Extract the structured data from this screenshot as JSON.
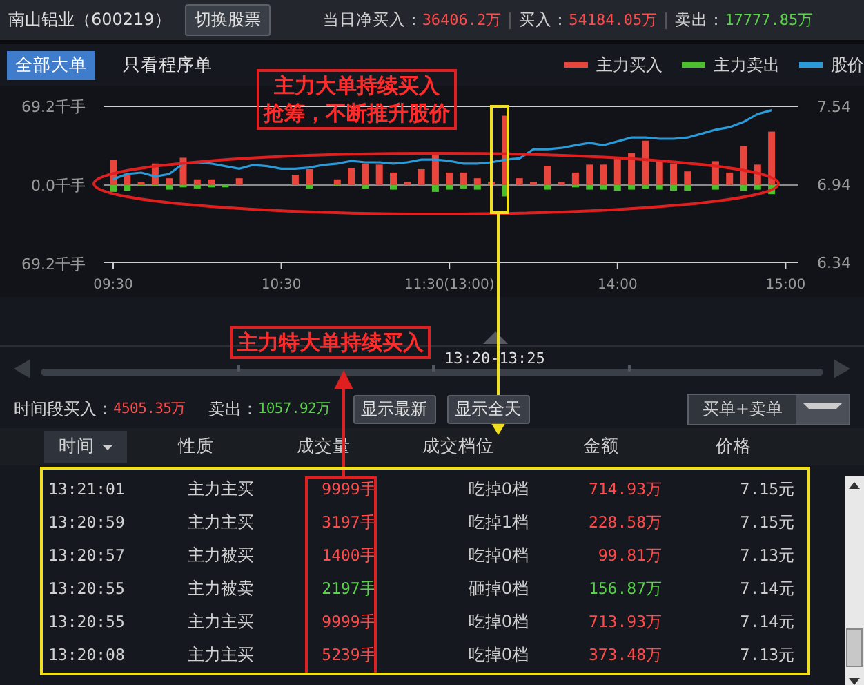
{
  "header": {
    "stock": "南山铝业（600219）",
    "switch_button": "切换股票",
    "stats": [
      {
        "label": "当日净买入：",
        "value": "36406.2万",
        "kind": "buy"
      },
      {
        "label": "买入：",
        "value": "54184.05万",
        "kind": "buy"
      },
      {
        "label": "卖出：",
        "value": "17777.85万",
        "kind": "sell"
      }
    ]
  },
  "tabs": [
    {
      "label": "全部大单",
      "selected": true
    },
    {
      "label": "只看程序单",
      "selected": false
    }
  ],
  "chart": {
    "volume": {
      "chart_data": {
        "type": "bar",
        "stacked": true,
        "categories": [
          "09:30",
          null,
          null,
          null,
          null,
          null,
          null,
          null,
          null,
          null,
          null,
          null,
          "10:30",
          null,
          null,
          null,
          null,
          null,
          null,
          null,
          null,
          null,
          null,
          null,
          "11:30(13:00)",
          null,
          null,
          null,
          null,
          null,
          null,
          null,
          null,
          null,
          null,
          null,
          "14:00",
          null,
          null,
          null,
          null,
          null,
          null,
          null,
          null,
          null,
          null,
          null,
          "15:00"
        ],
        "ylim": [
          -69.2,
          69.2
        ],
        "yticks": [
          {
            "value": 69.2,
            "label": "69.2千手"
          },
          {
            "value": 0,
            "label": "0.0千手"
          },
          {
            "value": -69.2,
            "label": "69.2千手"
          }
        ],
        "series": [
          {
            "name": "主力买入",
            "type": "bar",
            "color": "#e8453c",
            "values": [
              22,
              10,
              3,
              19,
              6,
              24,
              5,
              5,
              0,
              6,
              0,
              0,
              0,
              9,
              14,
              0,
              5,
              15,
              19,
              18,
              11,
              3,
              14,
              28,
              11,
              11,
              6,
              3,
              61,
              6,
              3,
              17,
              3,
              11,
              18,
              18,
              23,
              28,
              39,
              21,
              19,
              12,
              0,
              21,
              11,
              34,
              18,
              47,
              null
            ]
          },
          {
            "name": "主力卖出",
            "type": "bar",
            "color": "#4cc02c",
            "values": [
              -6,
              -5,
              -1,
              -1,
              -4,
              -2,
              -3,
              -2,
              -2,
              0,
              0,
              0,
              0,
              0,
              -3,
              0,
              -1,
              0,
              -3,
              0,
              -4,
              0,
              0,
              -6,
              -4,
              -3,
              -4,
              0,
              -10,
              0,
              0,
              -4,
              0,
              -2,
              -4,
              -4,
              -5,
              -4,
              -3,
              -4,
              -5,
              -5,
              0,
              -4,
              0,
              -5,
              -4,
              -8,
              null
            ]
          }
        ]
      }
    },
    "price": {
      "chart_data": {
        "type": "line",
        "ylim": [
          6.34,
          7.54
        ],
        "yticks": [
          {
            "value": 7.54,
            "label": "7.54"
          },
          {
            "value": 6.94,
            "label": "6.94"
          },
          {
            "value": 6.34,
            "label": "6.34"
          }
        ],
        "series": [
          {
            "name": "股价",
            "color": "#2a9ad8",
            "values": [
              6.98,
              7.02,
              7.03,
              7.0,
              7.02,
              7.1,
              7.11,
              7.1,
              7.08,
              7.06,
              7.09,
              7.08,
              7.06,
              7.06,
              7.07,
              7.09,
              7.1,
              7.12,
              7.11,
              7.11,
              7.1,
              7.11,
              7.13,
              7.13,
              7.12,
              7.1,
              7.1,
              7.11,
              7.13,
              7.14,
              7.21,
              7.21,
              7.22,
              7.24,
              7.26,
              7.24,
              7.27,
              7.3,
              7.3,
              7.29,
              7.29,
              7.3,
              7.33,
              7.36,
              7.38,
              7.42,
              7.48,
              7.51,
              null
            ]
          }
        ]
      }
    }
  },
  "range_label": "13:20-13:25",
  "period": [
    {
      "label": "时间段买入：",
      "value": "4505.35万",
      "kind": "buy"
    },
    {
      "label": "卖出：",
      "value": "1057.92万",
      "kind": "sell"
    }
  ],
  "buttons": [
    "显示最新",
    "显示全天"
  ],
  "filter": {
    "value": "买单+卖单"
  },
  "table": {
    "columns": [
      {
        "label": "时间",
        "selected": true
      },
      {
        "label": "性质",
        "selected": false
      },
      {
        "label": "成交量",
        "selected": false
      },
      {
        "label": "成交档位",
        "selected": false
      },
      {
        "label": "金额",
        "selected": false
      },
      {
        "label": "价格",
        "selected": false
      }
    ],
    "rows": [
      {
        "time": "13:21:01",
        "nature": "主力主买",
        "volume": "9999手",
        "level": "吃掉0档",
        "amount": "714.93万",
        "price": "7.15元",
        "kind": "buy"
      },
      {
        "time": "13:20:59",
        "nature": "主力主买",
        "volume": "3197手",
        "level": "吃掉1档",
        "amount": "228.58万",
        "price": "7.15元",
        "kind": "buy"
      },
      {
        "time": "13:20:57",
        "nature": "主力被买",
        "volume": "1400手",
        "level": "吃掉0档",
        "amount": "99.81万",
        "price": "7.13元",
        "kind": "buy"
      },
      {
        "time": "13:20:55",
        "nature": "主力被卖",
        "volume": "2197手",
        "level": "砸掉0档",
        "amount": "156.87万",
        "price": "7.14元",
        "kind": "sell"
      },
      {
        "time": "13:20:55",
        "nature": "主力主买",
        "volume": "9999手",
        "level": "吃掉0档",
        "amount": "713.93万",
        "price": "7.14元",
        "kind": "buy"
      },
      {
        "time": "13:20:08",
        "nature": "主力主买",
        "volume": "5239手",
        "level": "吃掉0档",
        "amount": "373.48万",
        "price": "7.13元",
        "kind": "buy"
      }
    ]
  },
  "annotations": [
    {
      "lines": [
        "主力大单持续买入",
        "抢筹，不断推升股价"
      ]
    },
    {
      "lines": [
        "主力特大单持续买入"
      ]
    }
  ]
}
